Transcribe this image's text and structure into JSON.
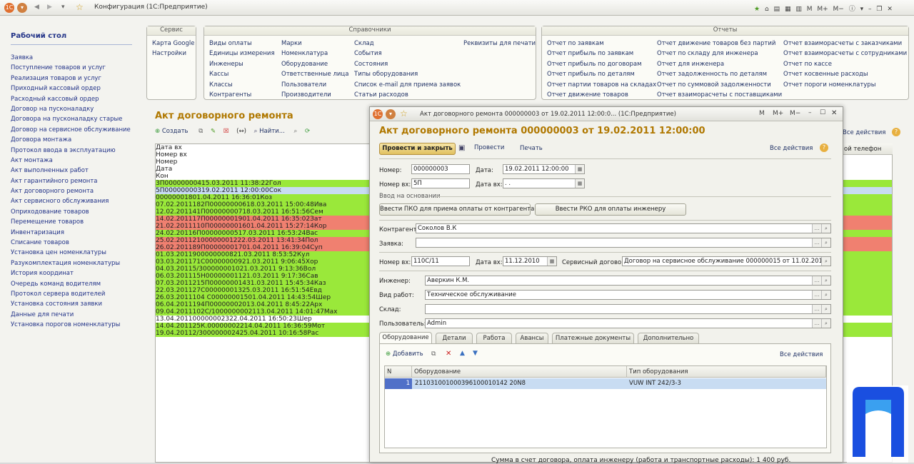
{
  "app": {
    "title": "Конфигурация  (1С:Предприятие)",
    "right_icons": [
      "M",
      "M+",
      "M−"
    ]
  },
  "sidebar": {
    "title": "Рабочий стол",
    "items": [
      "Заявка",
      "Поступление товаров и услуг",
      "Реализация товаров и услуг",
      "Приходный кассовый ордер",
      "Расходный кассовый ордер",
      "Договор на пусконаладку",
      "Договора на пусконаладку старые",
      "Договор на сервисное обслуживание",
      "Договора монтажа",
      "Протокол ввода в эксплуатацию",
      "Акт монтажа",
      "Акт выполненных работ",
      "Акт гарантийного ремонта",
      "Акт договорного ремонта",
      "Акт сервисного обслуживания",
      "Оприходование товаров",
      "Перемещение товаров",
      "Инвентаризация",
      "Списание товаров",
      "Установка цен номенклатуры",
      "Разукомплектация номенклатуры",
      "История координат",
      "Очередь команд водителям",
      "Протокол сервера водителей",
      "Установка состояния заявки",
      "Данные для печати",
      "Установка порогов номенклатуры"
    ]
  },
  "panels": {
    "service": {
      "title": "Сервис",
      "items": [
        "Карта Google",
        "Настройки"
      ]
    },
    "refs": {
      "title": "Справочники",
      "col1": [
        "Виды оплаты",
        "Единицы измерения",
        "Инженеры",
        "Кассы",
        "Классы",
        "Контрагенты"
      ],
      "col2": [
        "Марки",
        "Номенклатура",
        "Оборудование",
        "Ответственные лица",
        "Пользователи",
        "Производители"
      ],
      "col3": [
        "Склад",
        "События",
        "Состояния",
        "Типы оборудования",
        "Список e-mail для приема заявок",
        "Статьи расходов"
      ],
      "col4": [
        "Реквизиты для печати"
      ]
    },
    "reports": {
      "title": "Отчеты",
      "col1": [
        "Отчет по заявкам",
        "Отчет прибыль по заявкам",
        "Отчет прибыль по договорам",
        "Отчет прибыль по деталям",
        "Отчет партии товаров на складах",
        "Отчет движение товаров"
      ],
      "col2": [
        "Отчет движение товаров без партий",
        "Отчет по складу для инженера",
        "Отчет для инженера",
        "Отчет задолженность по деталям",
        "Отчет по суммовой задолженности",
        "Отчет взаиморасчеты с поставщиками"
      ],
      "col3": [
        "Отчет взаиморасчеты с заказчиками",
        "Отчет взаиморасчеты с сотрудниками",
        "Отчет по кассе",
        "Отчет косвенные расходы",
        "Отчет пороги номенклатуры"
      ]
    }
  },
  "list": {
    "title": "Акт договорного ремонта",
    "toolbar": {
      "create": "Создать",
      "find": "Найти...",
      "all_actions": "Все действия",
      "phone": "ой телефон"
    },
    "columns": [
      "Дата вх",
      "Номер вх",
      "Номер",
      "Дата",
      "Кон"
    ],
    "rows": [
      {
        "d": "",
        "nv": "3П",
        "n": "000000004",
        "dt": "15.03.2011 11:38:22",
        "k": "Гол",
        "c": "g"
      },
      {
        "d": "",
        "nv": "5П",
        "n": "000000003",
        "dt": "19.02.2011 12:00:00",
        "k": "Сок",
        "c": "s"
      },
      {
        "d": "",
        "nv": "",
        "n": "000000018",
        "dt": "01.04.2011 16:36:01",
        "k": "Коз",
        "c": "g"
      },
      {
        "d": "07.02.2011",
        "nv": "182П",
        "n": "000000006",
        "dt": "18.03.2011 15:00:48",
        "k": "Ива",
        "c": "g"
      },
      {
        "d": "12.02.2011",
        "nv": "41П",
        "n": "000000007",
        "dt": "18.03.2011 16:51:56",
        "k": "Сем",
        "c": "g"
      },
      {
        "d": "14.02.2011",
        "nv": "17П",
        "n": "000000019",
        "dt": "01.04.2011 16:35:02",
        "k": "Зат",
        "c": "r"
      },
      {
        "d": "21.02.2011",
        "nv": "110П",
        "n": "000000016",
        "dt": "01.04.2011 15:27:14",
        "k": "Кор",
        "c": "r"
      },
      {
        "d": "24.02.2011",
        "nv": "6П",
        "n": "000000005",
        "dt": "17.03.2011 16:53:24",
        "k": "Вас",
        "c": "g"
      },
      {
        "d": "25.02.2011",
        "nv": "21",
        "n": "000000012",
        "dt": "22.03.2011 13:41:34",
        "k": "Пол",
        "c": "r"
      },
      {
        "d": "26.02.2011",
        "nv": "89П",
        "n": "000000017",
        "dt": "01.04.2011 16:39:04",
        "k": "Суп",
        "c": "r"
      },
      {
        "d": "01.03.2011",
        "nv": "9",
        "n": "000000008",
        "dt": "21.03.2011 8:53:52",
        "k": "Кул",
        "c": "g"
      },
      {
        "d": "03.03.2011",
        "nv": "71С",
        "n": "000000009",
        "dt": "21.03.2011 9:06:45",
        "k": "Хор",
        "c": "g"
      },
      {
        "d": "04.03.2011",
        "nv": "5/3",
        "n": "000000010",
        "dt": "21.03.2011 9:13:36",
        "k": "Вол",
        "c": "g"
      },
      {
        "d": "06.03.2011",
        "nv": "15Н",
        "n": "000000011",
        "dt": "21.03.2011 9:17:36",
        "k": "Сав",
        "c": "g"
      },
      {
        "d": "07.03.2011",
        "nv": "215П",
        "n": "000000014",
        "dt": "31.03.2011 15:45:34",
        "k": "Каз",
        "c": "g"
      },
      {
        "d": "22.03.2011",
        "nv": "27С",
        "n": "000000013",
        "dt": "25.03.2011 16:51:54",
        "k": "Евд",
        "c": "g"
      },
      {
        "d": "26.03.2011",
        "nv": "104 С",
        "n": "000000015",
        "dt": "01.04.2011 14:43:54",
        "k": "Шер",
        "c": "g"
      },
      {
        "d": "06.04.2011",
        "nv": "194П",
        "n": "000000020",
        "dt": "13.04.2011 8:45:22",
        "k": "Арх",
        "c": "g"
      },
      {
        "d": "09.04.2011",
        "nv": "102С/10",
        "n": "000000021",
        "dt": "13.04.2011 14:01:47",
        "k": "Мах",
        "c": "g"
      },
      {
        "d": "13.04.2011",
        "nv": "",
        "n": "000000023",
        "dt": "22.04.2011 16:50:23",
        "k": "Шер",
        "c": "w"
      },
      {
        "d": "14.04.2011",
        "nv": "25К.",
        "n": "000000022",
        "dt": "14.04.2011 16:36:59",
        "k": "Мот",
        "c": "g"
      },
      {
        "d": "19.04.2011",
        "nv": "2/3",
        "n": "000000024",
        "dt": "25.04.2011 10:16:58",
        "k": "Рас",
        "c": "g"
      }
    ]
  },
  "dialog": {
    "window_title": "Акт договорного ремонта 000000003 от 19.02.2011 12:00:0...  (1С:Предприятие)",
    "heading": "Акт договорного ремонта 000000003 от 19.02.2011 12:00:00",
    "post_close": "Провести и закрыть",
    "post": "Провести",
    "print": "Печать",
    "all_actions": "Все действия",
    "labels": {
      "number": "Номер:",
      "date": "Дата:",
      "number_in": "Номер вх:",
      "date_in": "Дата вх:",
      "basis": "Ввод на основании",
      "contractor": "Контрагент:",
      "request": "Заявка:",
      "number_in2": "Номер вх:",
      "date_in2": "Дата вх:",
      "service_contract": "Сервисный договор:",
      "engineer": "Инженер:",
      "work_type": "Вид работ:",
      "warehouse": "Склад:",
      "user": "Пользователь:"
    },
    "values": {
      "number": "000000003",
      "date": "19.02.2011 12:00:00",
      "number_in": "5П",
      "date_in": " .  .",
      "contractor": "Соколов В.К",
      "request": "",
      "number_in2": "110С/11",
      "date_in2": "11.12.2010",
      "service_contract": "Договор на сервисное обслуживание 000000015 от 11.02.2011 1",
      "engineer": "Аверкин К.М.",
      "work_type": "Техническое обслуживание",
      "warehouse": "",
      "user": "Admin"
    },
    "basis_buttons": [
      "Ввести ПКО для приема оплаты от контрагента",
      "Ввести РКО для оплаты инженеру"
    ],
    "tabs": [
      "Оборудование",
      "Детали",
      "Работа",
      "Авансы",
      "Платежные документы",
      "Дополнительно"
    ],
    "sub_toolbar": {
      "add": "Добавить",
      "all_actions": "Все действия"
    },
    "table": {
      "columns": [
        "N",
        "Оборудование",
        "Тип оборудования"
      ],
      "rows": [
        {
          "n": "1",
          "eq": "211031001000396100010142 20N8",
          "type": "VUW INT 242/3-3"
        }
      ]
    },
    "footer": "Сумма в счет договора, оплата инженеру (работа и транспортные расходы): 1 400 руб."
  },
  "colors": {
    "green": "#9ae83a",
    "red": "#f08070",
    "selected": "#c8dcf2",
    "accent": "#b07800"
  }
}
